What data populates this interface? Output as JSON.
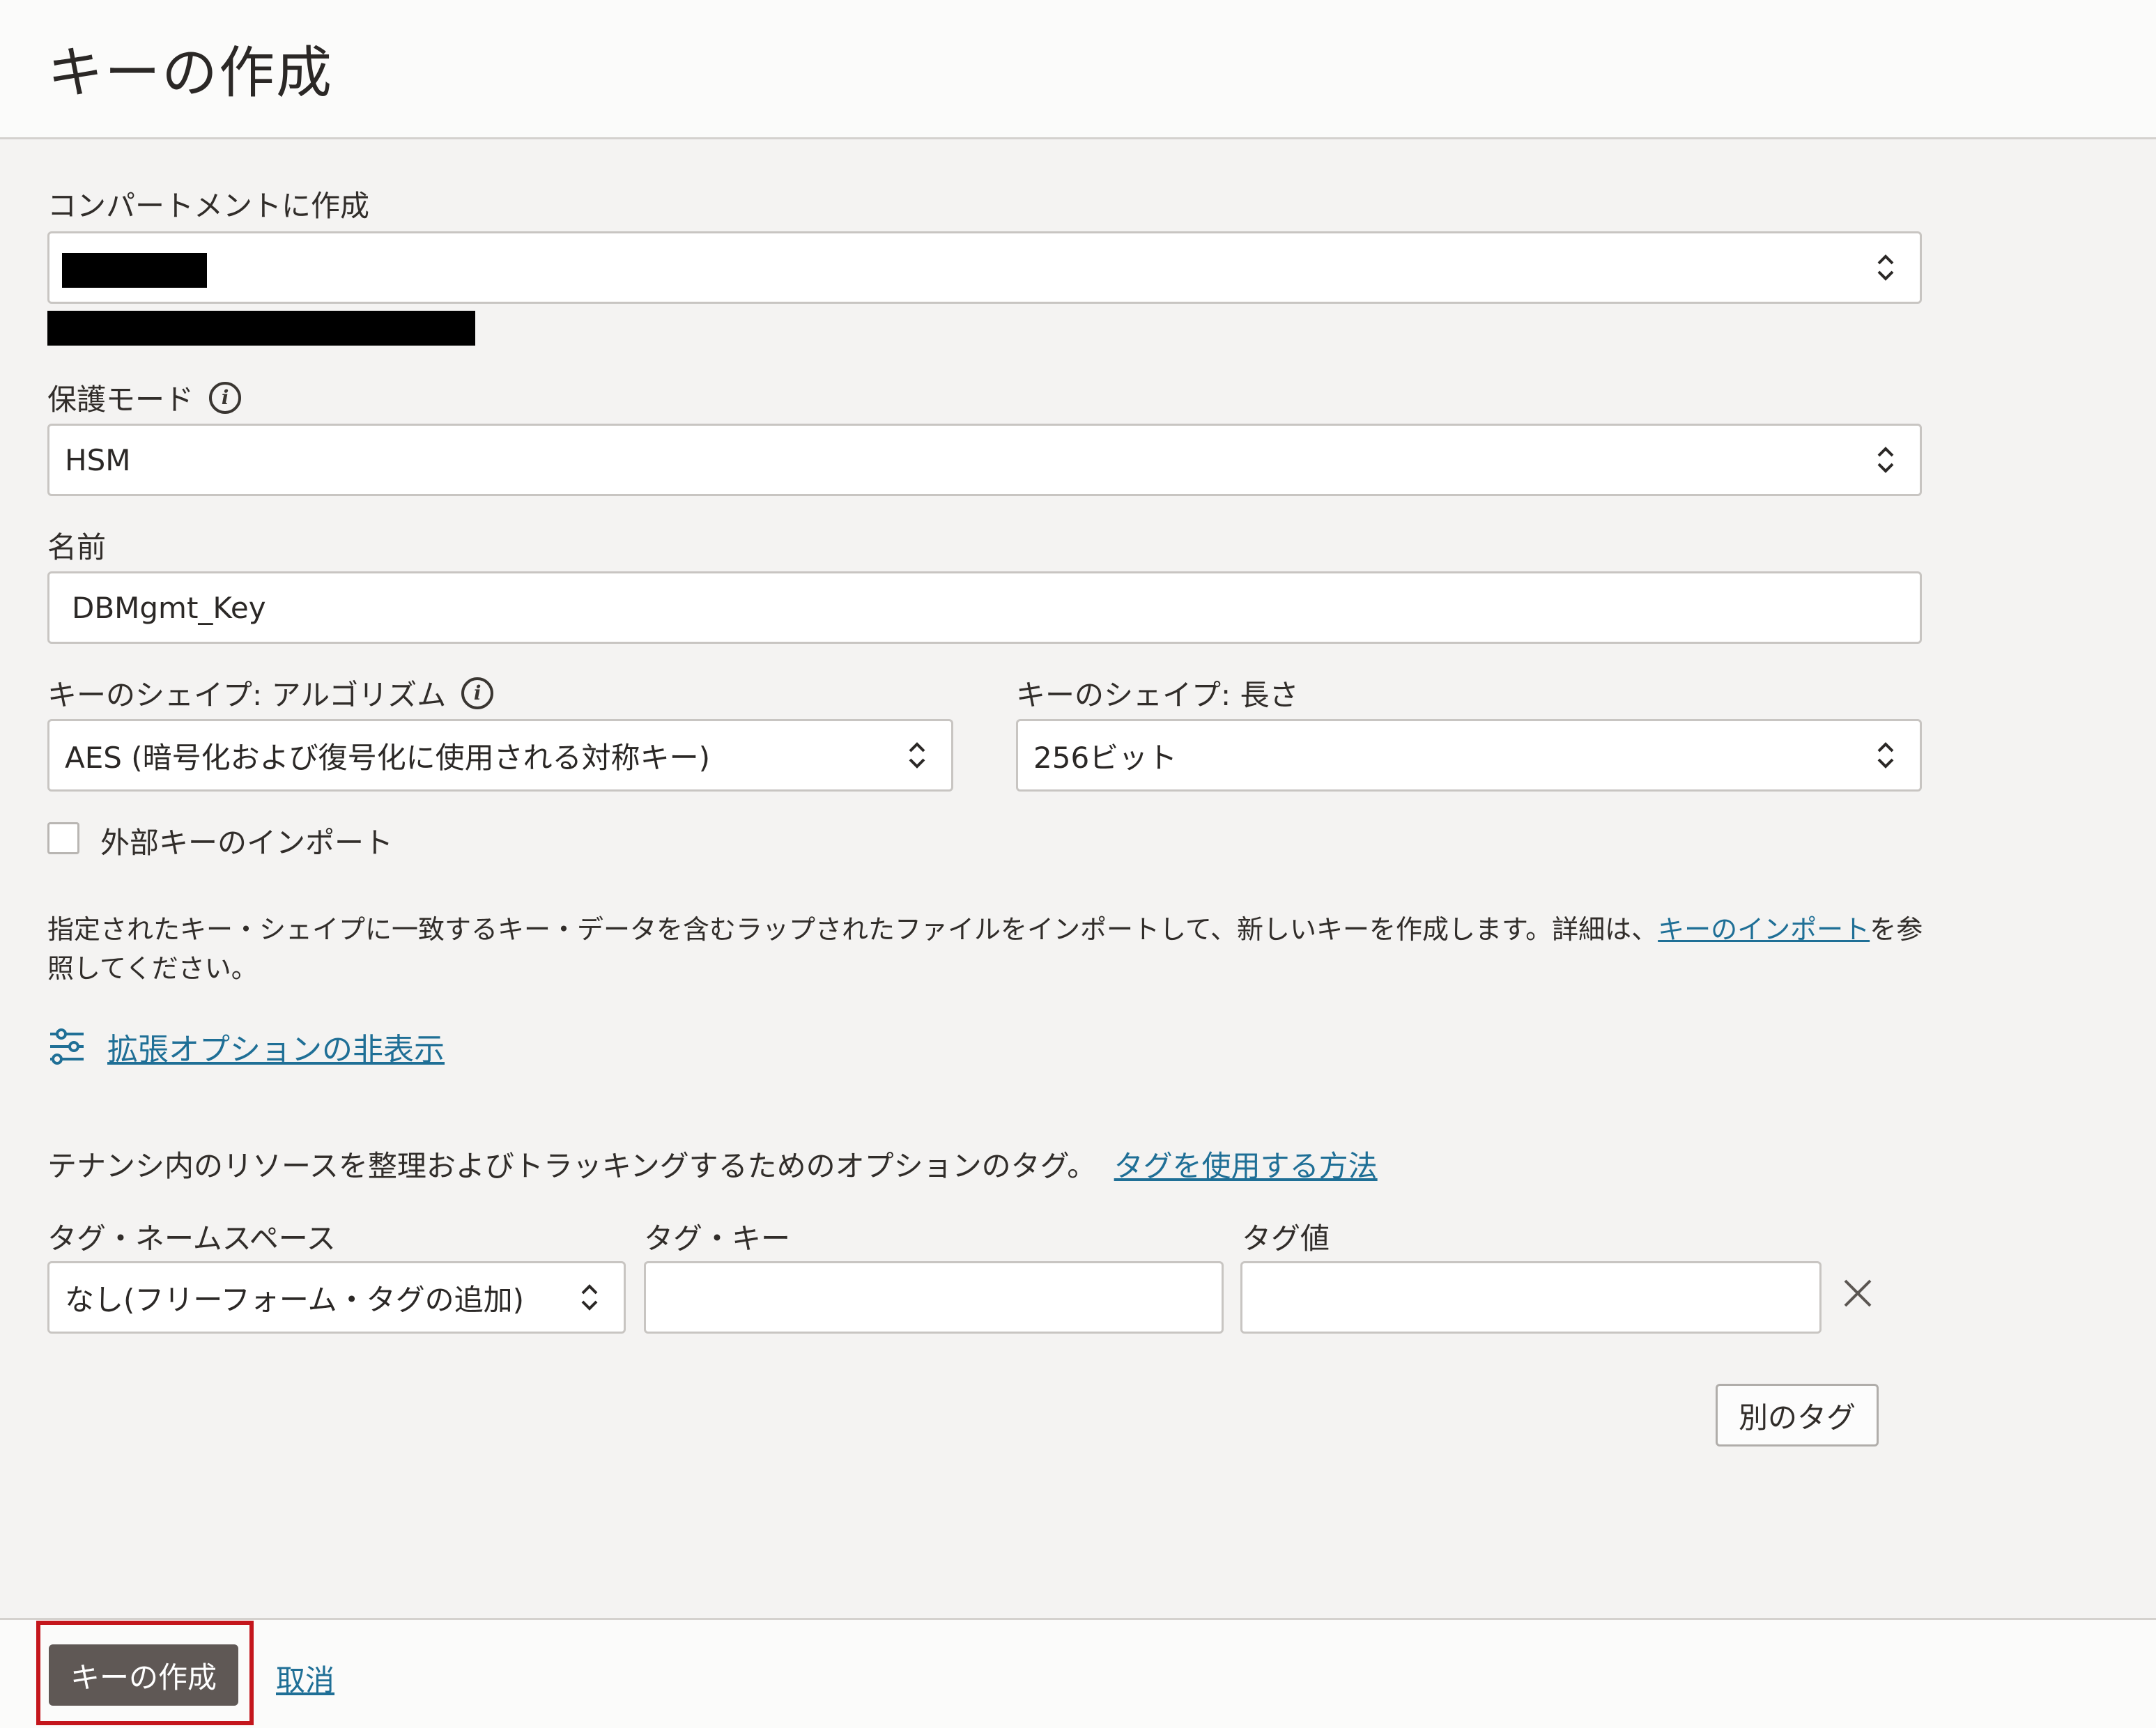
{
  "page": {
    "title": "キーの作成"
  },
  "compartment": {
    "label": "コンパートメントに作成"
  },
  "protection_mode": {
    "label": "保護モード",
    "value": "HSM"
  },
  "name": {
    "label": "名前",
    "value": "DBMgmt_Key"
  },
  "key_shape": {
    "algorithm_label": "キーのシェイプ: アルゴリズム",
    "algorithm_value": "AES (暗号化および復号化に使用される対称キー)",
    "length_label": "キーのシェイプ: 長さ",
    "length_value": "256ビット"
  },
  "import": {
    "checkbox_label": "外部キーのインポート",
    "checked": false,
    "help_before": "指定されたキー・シェイプに一致するキー・データを含むラップされたファイルをインポートして、新しいキーを作成します。詳細は、",
    "help_link": "キーのインポート",
    "help_after": "を参照してください。"
  },
  "advanced": {
    "link_label": "拡張オプションの非表示",
    "icon": "sliders-icon"
  },
  "tags": {
    "description": "テナンシ内のリソースを整理およびトラッキングするためのオプションのタグ。",
    "help_link": "タグを使用する方法",
    "namespace_label": "タグ・ネームスペース",
    "namespace_value": "なし(フリーフォーム・タグの追加)",
    "key_label": "タグ・キー",
    "key_value": "",
    "value_label": "タグ値",
    "value_value": "",
    "add_another": "別のタグ"
  },
  "footer": {
    "create_button": "キーの作成",
    "cancel_link": "取消"
  },
  "colors": {
    "link": "#1f6f96",
    "primary_button": "#5f5855",
    "highlight": "#c4161c"
  }
}
